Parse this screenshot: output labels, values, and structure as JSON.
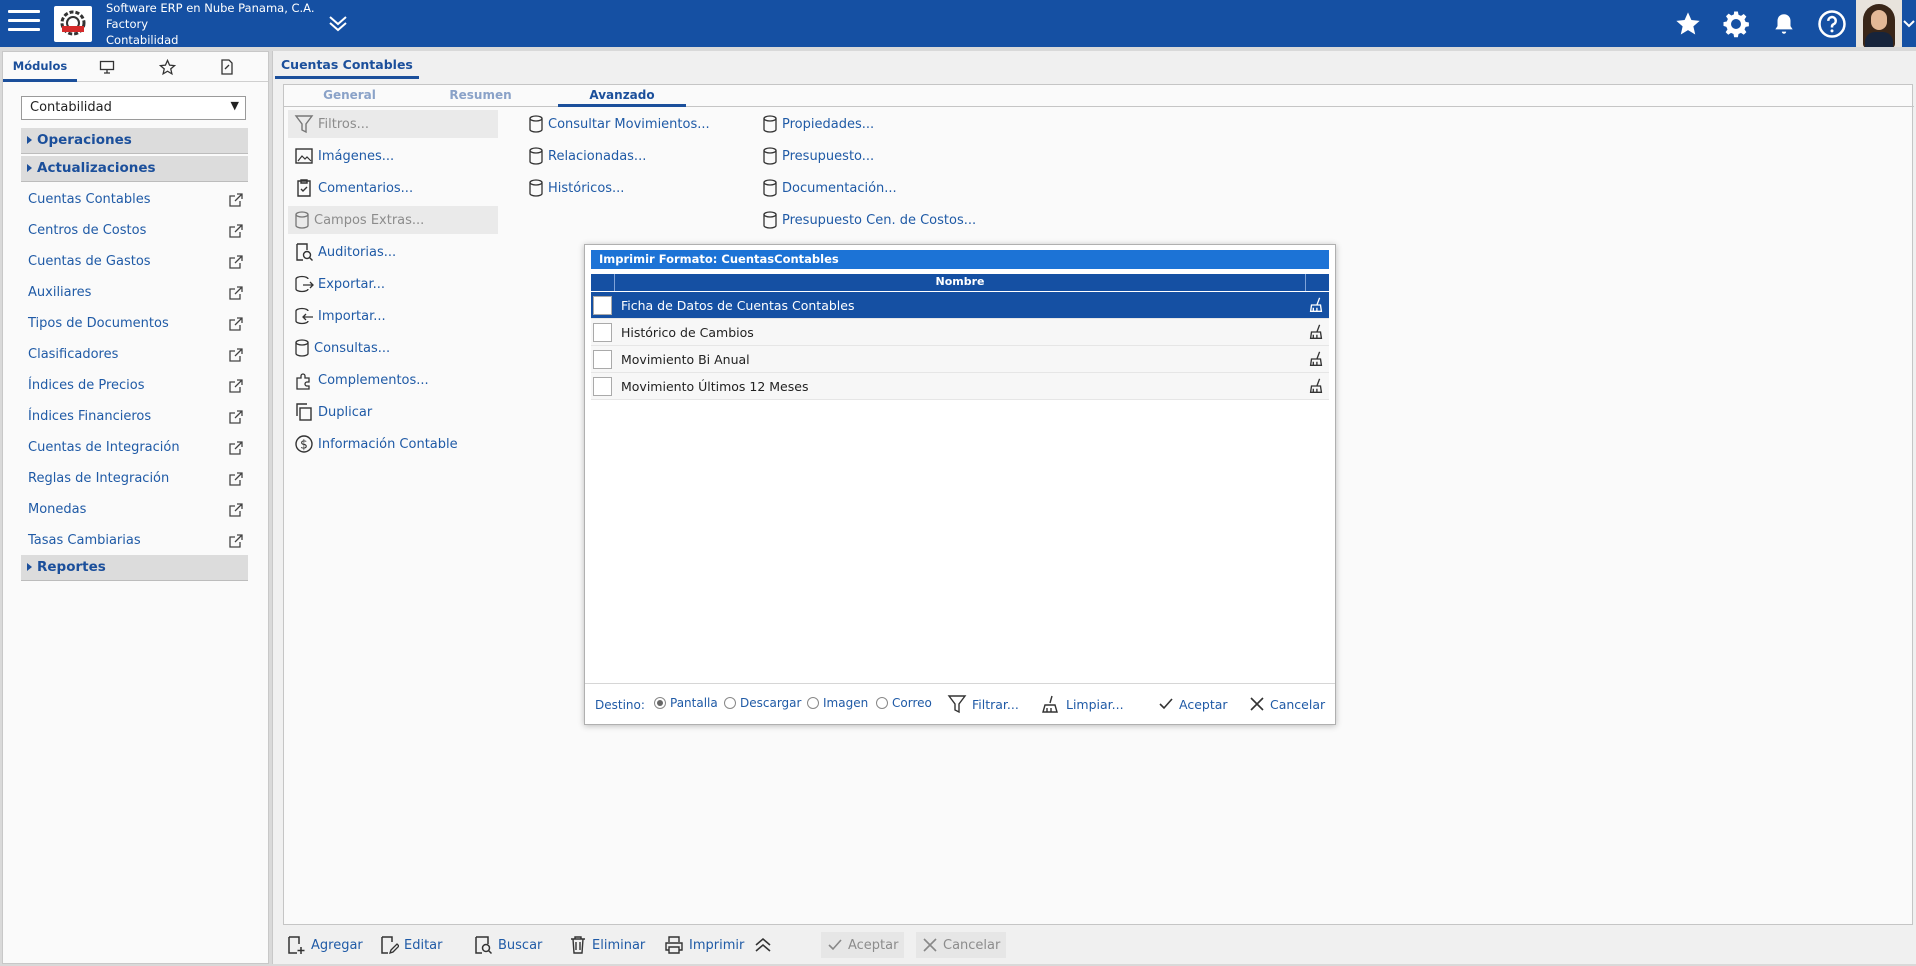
{
  "header": {
    "company_line1": "Software ERP en Nube Panama, C.A.",
    "company_line2": "Factory",
    "company_line3": "Contabilidad",
    "colors": {
      "bar": "#1550a3",
      "accent": "#1c73d6"
    }
  },
  "sidebar": {
    "tabs": {
      "modules_label": "Módulos"
    },
    "module_select": "Contabilidad",
    "sections": {
      "operaciones": "Operaciones",
      "actualizaciones": "Actualizaciones",
      "reportes": "Reportes"
    },
    "items": [
      "Cuentas Contables",
      "Centros de Costos",
      "Cuentas de Gastos",
      "Auxiliares",
      "Tipos de Documentos",
      "Clasificadores",
      "Índices de Precios",
      "Índices Financieros",
      "Cuentas de Integración",
      "Reglas de Integración",
      "Monedas",
      "Tasas Cambiarias"
    ]
  },
  "main": {
    "tab_title": "Cuentas Contables",
    "subtabs": {
      "general": "General",
      "resumen": "Resumen",
      "avanzado": "Avanzado"
    },
    "actions_col1": [
      "Filtros...",
      "Imágenes...",
      "Comentarios...",
      "Campos Extras...",
      "Auditorias...",
      "Exportar...",
      "Importar...",
      "Consultas...",
      "Complementos...",
      "Duplicar",
      "Información Contable"
    ],
    "actions_col2": [
      "Consultar Movimientos...",
      "Relacionadas...",
      "Históricos..."
    ],
    "actions_col3": [
      "Propiedades...",
      "Presupuesto...",
      "Documentación...",
      "Presupuesto Cen. de Costos..."
    ]
  },
  "dialog": {
    "title": "Imprimir Formato: CuentasContables",
    "column_header": "Nombre",
    "rows": [
      "Ficha de Datos de Cuentas Contables",
      "Histórico de Cambios",
      "Movimiento Bi Anual",
      "Movimiento Últimos 12 Meses"
    ],
    "destino_label": "Destino:",
    "destinations": {
      "pantalla": "Pantalla",
      "descargar": "Descargar",
      "imagen": "Imagen",
      "correo": "Correo"
    },
    "buttons": {
      "filtrar": "Filtrar...",
      "limpiar": "Limpiar...",
      "aceptar": "Aceptar",
      "cancelar": "Cancelar"
    }
  },
  "toolbar": {
    "agregar": "Agregar",
    "editar": "Editar",
    "buscar": "Buscar",
    "eliminar": "Eliminar",
    "imprimir": "Imprimir",
    "aceptar": "Aceptar",
    "cancelar": "Cancelar"
  }
}
